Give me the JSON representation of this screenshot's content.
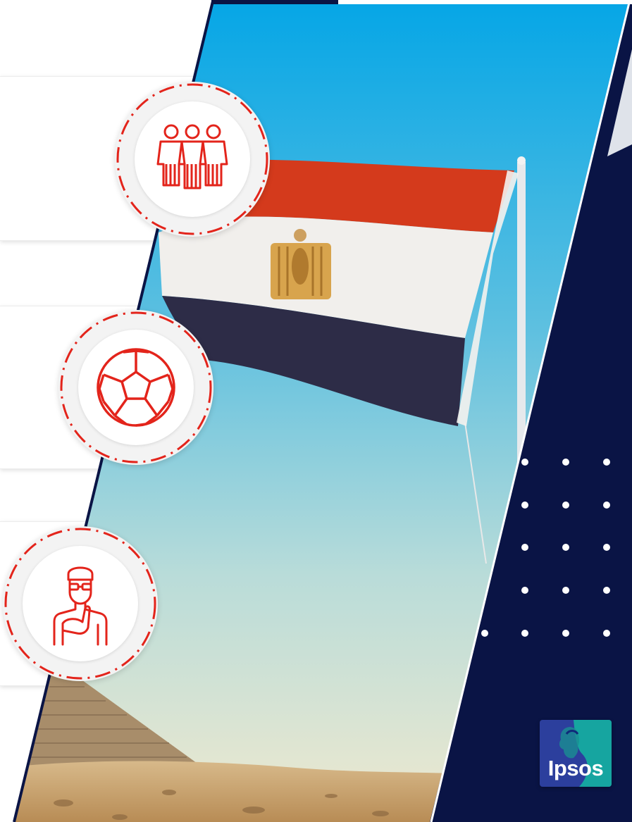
{
  "colors": {
    "navy": "#0a1445",
    "accent_red": "#e3241b",
    "sky_top": "#0aa5e5",
    "sky_bottom": "#e9ead6",
    "flag_red": "#d23a1a",
    "flag_white": "#f3f1ee",
    "flag_black": "#2f2e48",
    "eagle_gold": "#d9a24a",
    "logo_blue": "#2c3f9d",
    "logo_teal": "#16a5a0"
  },
  "icons": [
    {
      "name": "football-team-icon"
    },
    {
      "name": "soccer-ball-icon"
    },
    {
      "name": "thinking-fan-icon"
    }
  ],
  "logo": {
    "text": "Ipsos"
  }
}
